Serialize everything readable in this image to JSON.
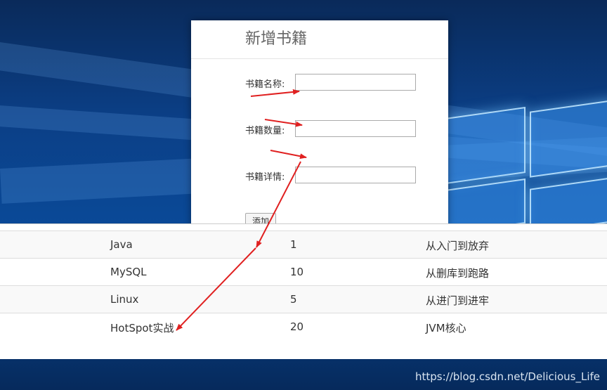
{
  "form": {
    "title": "新增书籍",
    "fields": [
      {
        "label": "书籍名称:",
        "value": ""
      },
      {
        "label": "书籍数量:",
        "value": ""
      },
      {
        "label": "书籍详情:",
        "value": ""
      }
    ],
    "add_button_label": "添加"
  },
  "table": {
    "rows": [
      {
        "name": "Java",
        "count": "1",
        "detail": "从入门到放弃"
      },
      {
        "name": "MySQL",
        "count": "10",
        "detail": "从删库到跑路"
      },
      {
        "name": "Linux",
        "count": "5",
        "detail": "从进门到进牢"
      },
      {
        "name": "HotSpot实战",
        "count": "20",
        "detail": "JVM核心"
      }
    ]
  },
  "watermark": "https://blog.csdn.net/Delicious_Life",
  "colors": {
    "annotation_arrow": "#e02020",
    "desktop_blue": "#0b3f86"
  }
}
